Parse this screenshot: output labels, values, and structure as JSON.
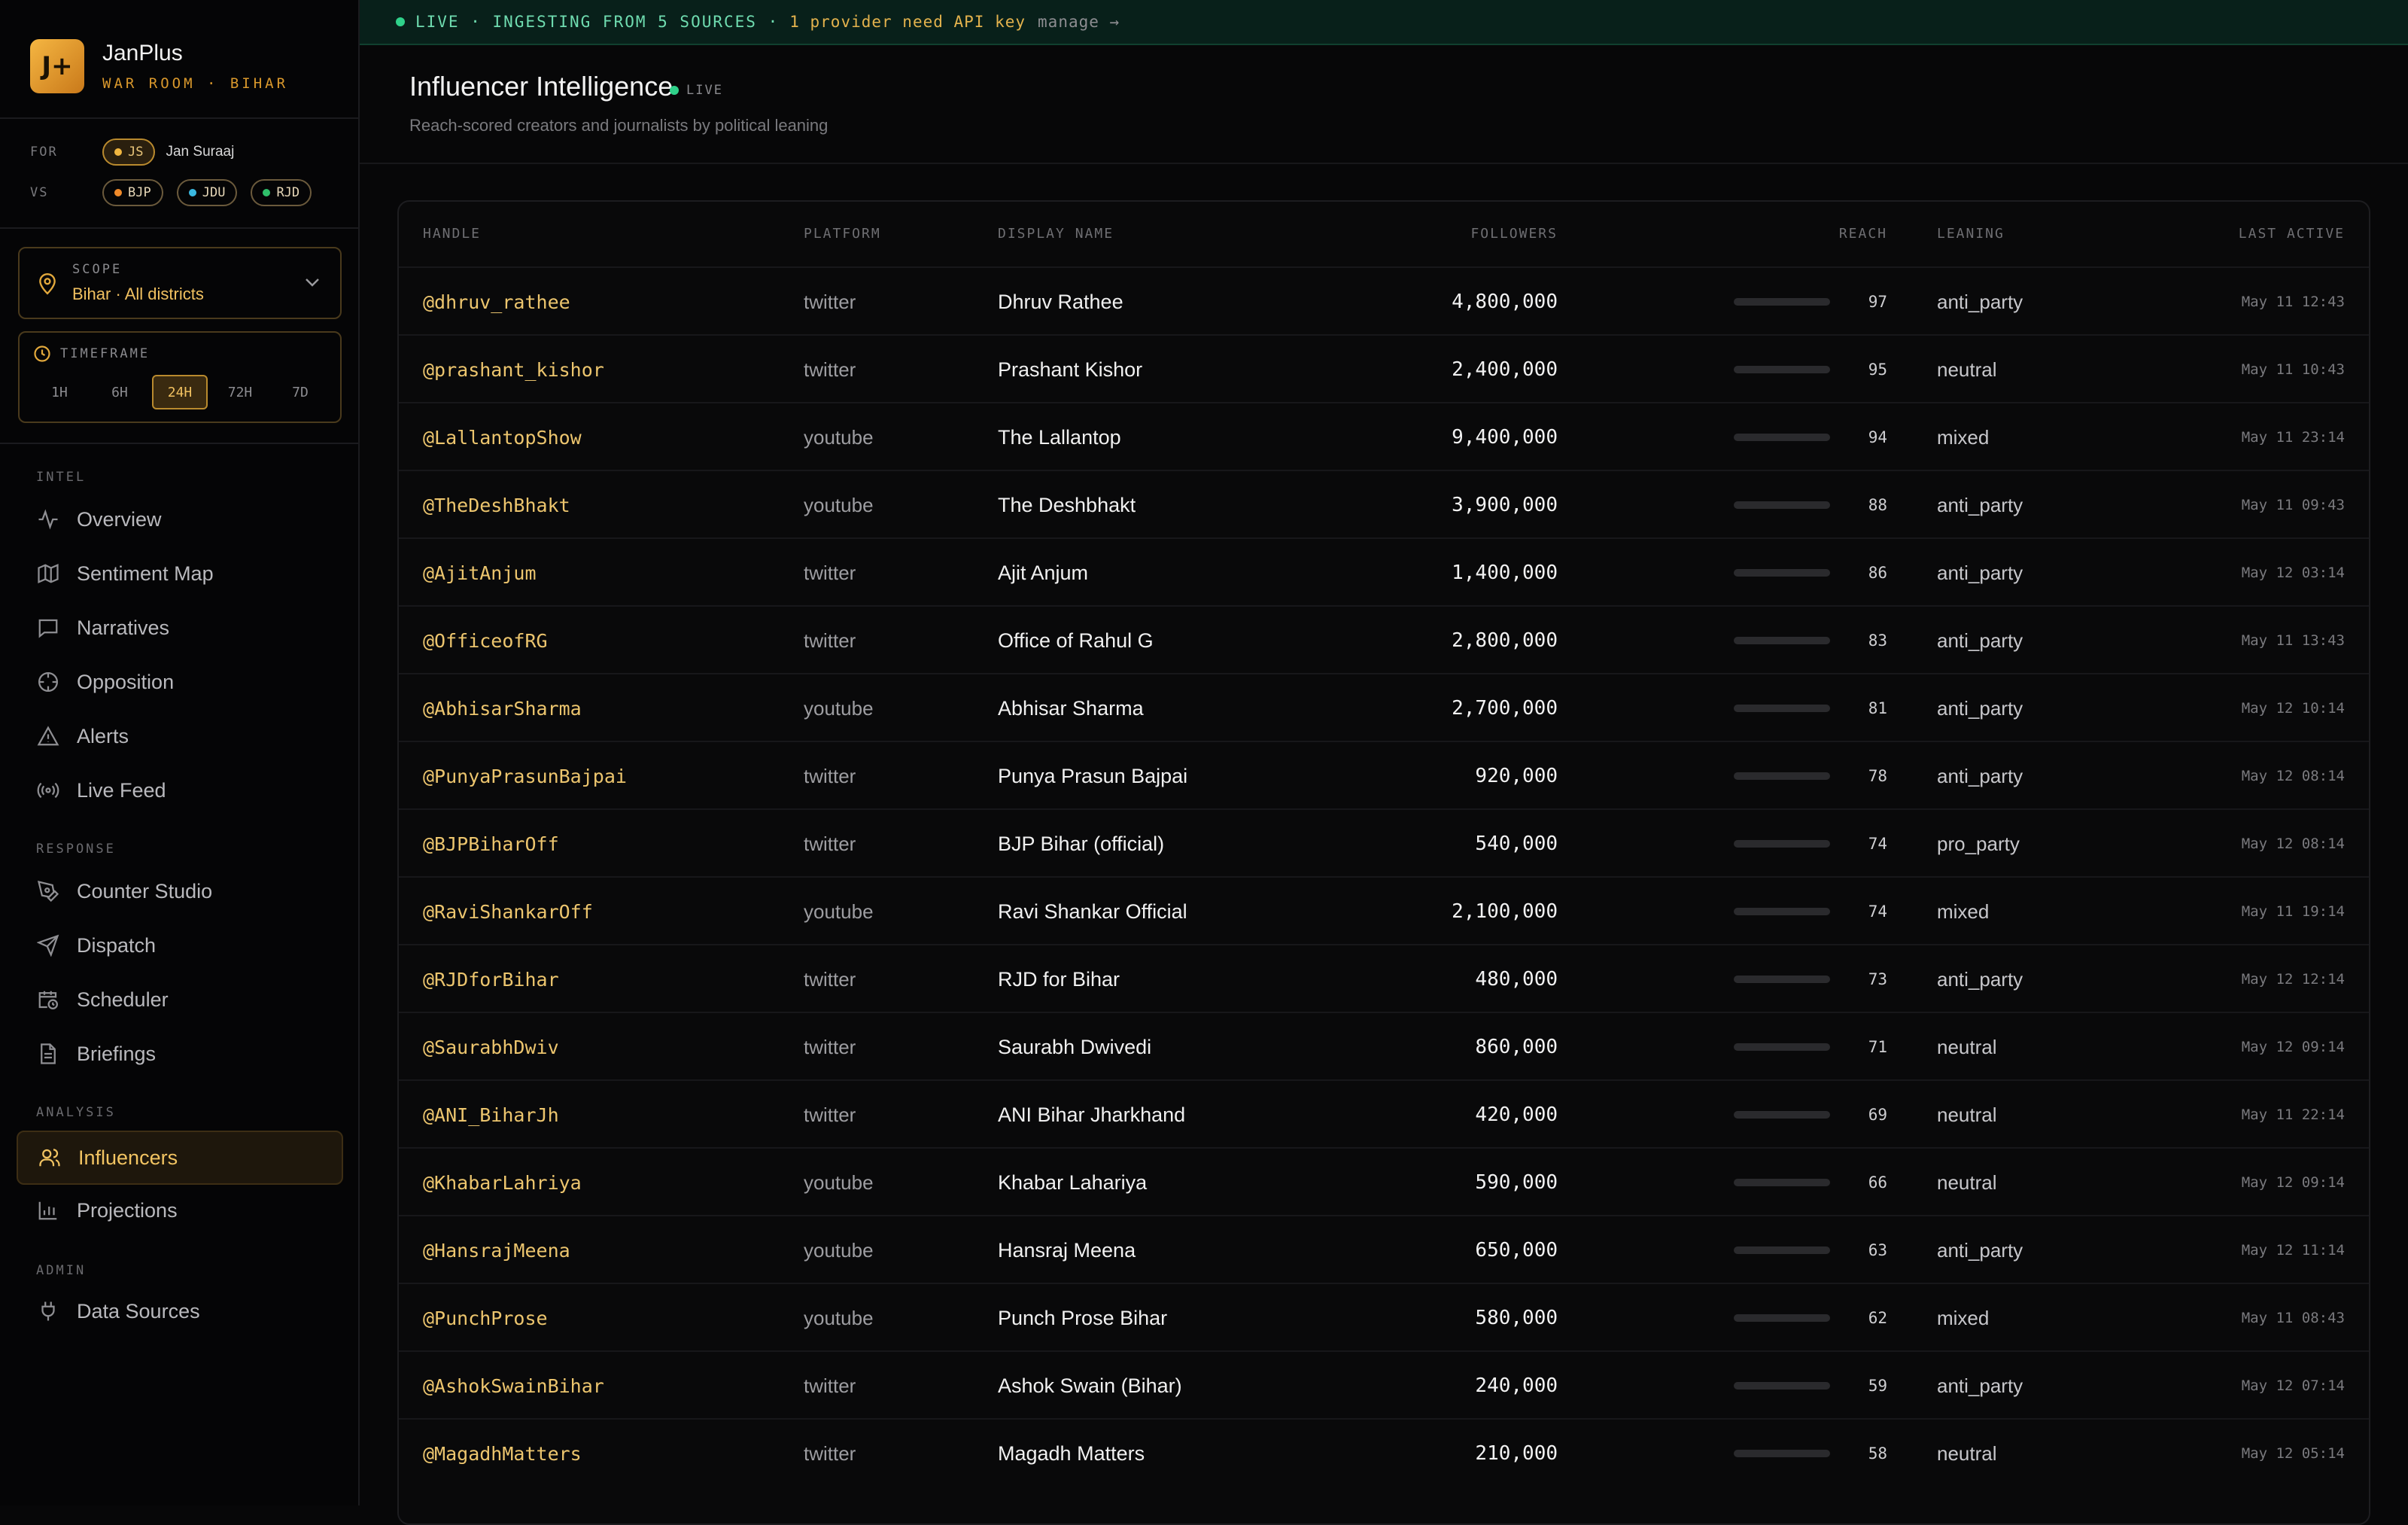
{
  "app": {
    "logo_text": "J+",
    "name": "JanPlus",
    "subtitle": "WAR ROOM · BIHAR"
  },
  "parties": {
    "for_label": "FOR",
    "vs_label": "VS",
    "for": [
      {
        "abbr": "JS",
        "name": "Jan Suraaj",
        "color": "#f0b640"
      }
    ],
    "vs": [
      {
        "abbr": "BJP",
        "color": "#f08a2a"
      },
      {
        "abbr": "JDU",
        "color": "#3ab8e0"
      },
      {
        "abbr": "RJD",
        "color": "#2fbf6a"
      }
    ]
  },
  "scope": {
    "label": "SCOPE",
    "value": "Bihar · All districts"
  },
  "timeframe": {
    "label": "TIMEFRAME",
    "options": [
      "1H",
      "6H",
      "24H",
      "72H",
      "7D"
    ],
    "selected": "24H"
  },
  "nav": {
    "intel": {
      "label": "INTEL",
      "items": [
        "Overview",
        "Sentiment Map",
        "Narratives",
        "Opposition",
        "Alerts",
        "Live Feed"
      ]
    },
    "response": {
      "label": "RESPONSE",
      "items": [
        "Counter Studio",
        "Dispatch",
        "Scheduler",
        "Briefings"
      ]
    },
    "analysis": {
      "label": "ANALYSIS",
      "items": [
        "Influencers",
        "Projections"
      ],
      "active": "Influencers"
    },
    "admin": {
      "label": "ADMIN",
      "items": [
        "Data Sources"
      ]
    }
  },
  "banner": {
    "live_text": "LIVE · INGESTING FROM 5 SOURCES ·",
    "warning": "1 provider need API key",
    "manage": "manage →"
  },
  "header": {
    "title": "Influencer Intelligence",
    "live_badge": "LIVE",
    "subtitle": "Reach-scored creators and journalists by political leaning"
  },
  "table": {
    "columns": {
      "handle": "HANDLE",
      "platform": "PLATFORM",
      "display_name": "DISPLAY NAME",
      "followers": "FOLLOWERS",
      "reach": "REACH",
      "leaning": "LEANING",
      "last_active": "LAST ACTIVE"
    },
    "rows": [
      {
        "handle": "@dhruv_rathee",
        "platform": "twitter",
        "name": "Dhruv Rathee",
        "followers": "4,800,000",
        "reach": 97,
        "leaning": "anti_party",
        "last_active": "May 11 12:43"
      },
      {
        "handle": "@prashant_kishor",
        "platform": "twitter",
        "name": "Prashant Kishor",
        "followers": "2,400,000",
        "reach": 95,
        "leaning": "neutral",
        "last_active": "May 11 10:43"
      },
      {
        "handle": "@LallantopShow",
        "platform": "youtube",
        "name": "The Lallantop",
        "followers": "9,400,000",
        "reach": 94,
        "leaning": "mixed",
        "last_active": "May 11 23:14"
      },
      {
        "handle": "@TheDeshBhakt",
        "platform": "youtube",
        "name": "The Deshbhakt",
        "followers": "3,900,000",
        "reach": 88,
        "leaning": "anti_party",
        "last_active": "May 11 09:43"
      },
      {
        "handle": "@AjitAnjum",
        "platform": "twitter",
        "name": "Ajit Anjum",
        "followers": "1,400,000",
        "reach": 86,
        "leaning": "anti_party",
        "last_active": "May 12 03:14"
      },
      {
        "handle": "@OfficeofRG",
        "platform": "twitter",
        "name": "Office of Rahul G",
        "followers": "2,800,000",
        "reach": 83,
        "leaning": "anti_party",
        "last_active": "May 11 13:43"
      },
      {
        "handle": "@AbhisarSharma",
        "platform": "youtube",
        "name": "Abhisar Sharma",
        "followers": "2,700,000",
        "reach": 81,
        "leaning": "anti_party",
        "last_active": "May 12 10:14"
      },
      {
        "handle": "@PunyaPrasunBajpai",
        "platform": "twitter",
        "name": "Punya Prasun Bajpai",
        "followers": "920,000",
        "reach": 78,
        "leaning": "anti_party",
        "last_active": "May 12 08:14"
      },
      {
        "handle": "@BJPBiharOff",
        "platform": "twitter",
        "name": "BJP Bihar (official)",
        "followers": "540,000",
        "reach": 74,
        "leaning": "pro_party",
        "last_active": "May 12 08:14"
      },
      {
        "handle": "@RaviShankarOff",
        "platform": "youtube",
        "name": "Ravi Shankar Official",
        "followers": "2,100,000",
        "reach": 74,
        "leaning": "mixed",
        "last_active": "May 11 19:14"
      },
      {
        "handle": "@RJDforBihar",
        "platform": "twitter",
        "name": "RJD for Bihar",
        "followers": "480,000",
        "reach": 73,
        "leaning": "anti_party",
        "last_active": "May 12 12:14"
      },
      {
        "handle": "@SaurabhDwiv",
        "platform": "twitter",
        "name": "Saurabh Dwivedi",
        "followers": "860,000",
        "reach": 71,
        "leaning": "neutral",
        "last_active": "May 12 09:14"
      },
      {
        "handle": "@ANI_BiharJh",
        "platform": "twitter",
        "name": "ANI Bihar Jharkhand",
        "followers": "420,000",
        "reach": 69,
        "leaning": "neutral",
        "last_active": "May 11 22:14"
      },
      {
        "handle": "@KhabarLahriya",
        "platform": "youtube",
        "name": "Khabar Lahariya",
        "followers": "590,000",
        "reach": 66,
        "leaning": "neutral",
        "last_active": "May 12 09:14"
      },
      {
        "handle": "@HansrajMeena",
        "platform": "youtube",
        "name": "Hansraj Meena",
        "followers": "650,000",
        "reach": 63,
        "leaning": "anti_party",
        "last_active": "May 12 11:14"
      },
      {
        "handle": "@PunchProse",
        "platform": "youtube",
        "name": "Punch Prose Bihar",
        "followers": "580,000",
        "reach": 62,
        "leaning": "mixed",
        "last_active": "May 11 08:43"
      },
      {
        "handle": "@AshokSwainBihar",
        "platform": "twitter",
        "name": "Ashok Swain (Bihar)",
        "followers": "240,000",
        "reach": 59,
        "leaning": "anti_party",
        "last_active": "May 12 07:14"
      },
      {
        "handle": "@MagadhMatters",
        "platform": "twitter",
        "name": "Magadh Matters",
        "followers": "210,000",
        "reach": 58,
        "leaning": "neutral",
        "last_active": "May 12 05:14"
      }
    ]
  }
}
